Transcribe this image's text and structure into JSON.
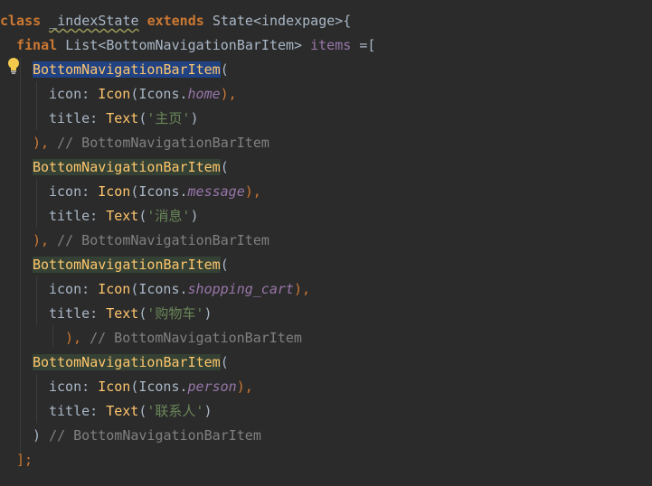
{
  "code": {
    "l1": {
      "kw_class": "class",
      "class_name": "_indexState",
      "kw_extends": "extends",
      "base": "State<indexpage>{"
    },
    "l2": {
      "kw_final": "final",
      "type": "List<BottomNavigationBarItem>",
      "field": "items",
      "assign": "=["
    },
    "items": [
      {
        "ctor": "BottomNavigationBarItem",
        "open": "(",
        "icon_label": "icon:",
        "icon_ctor": "Icon",
        "icons_ref": "(Icons.",
        "icon_name": "home",
        "icon_close": "),",
        "title_label": "title:",
        "text_ctor": "Text",
        "text_open": "(",
        "text_value": "'主页'",
        "text_close": ")",
        "close": "),",
        "comment": "// BottomNavigationBarItem"
      },
      {
        "ctor": "BottomNavigationBarItem",
        "open": "(",
        "icon_label": "icon:",
        "icon_ctor": "Icon",
        "icons_ref": "(Icons.",
        "icon_name": "message",
        "icon_close": "),",
        "title_label": "title:",
        "text_ctor": "Text",
        "text_open": "(",
        "text_value": "'消息'",
        "text_close": ")",
        "close": "),",
        "comment": "// BottomNavigationBarItem"
      },
      {
        "ctor": "BottomNavigationBarItem",
        "open": "(",
        "icon_label": "icon:",
        "icon_ctor": "Icon",
        "icons_ref": "(Icons.",
        "icon_name": "shopping_cart",
        "icon_close": "),",
        "title_label": "title:",
        "text_ctor": "Text",
        "text_open": "(",
        "text_value": "'购物车'",
        "text_close": ")",
        "close": "),",
        "comment": "// BottomNavigationBarItem"
      },
      {
        "ctor": "BottomNavigationBarItem",
        "open": "(",
        "icon_label": "icon:",
        "icon_ctor": "Icon",
        "icons_ref": "(Icons.",
        "icon_name": "person",
        "icon_close": "),",
        "title_label": "title:",
        "text_ctor": "Text",
        "text_open": "(",
        "text_value": "'联系人'",
        "text_close": ")",
        "close": ")",
        "comment": "// BottomNavigationBarItem"
      }
    ],
    "end": "];"
  },
  "gutter": {
    "icon": "lightbulb-icon"
  },
  "colors": {
    "background": "#2b2b2b",
    "keyword": "#cc7832",
    "constructor": "#ffc66d",
    "field": "#9876aa",
    "string": "#6a8759",
    "comment": "#808080",
    "text": "#a9b7c6",
    "selection": "#214283",
    "match_highlight": "#344134"
  }
}
